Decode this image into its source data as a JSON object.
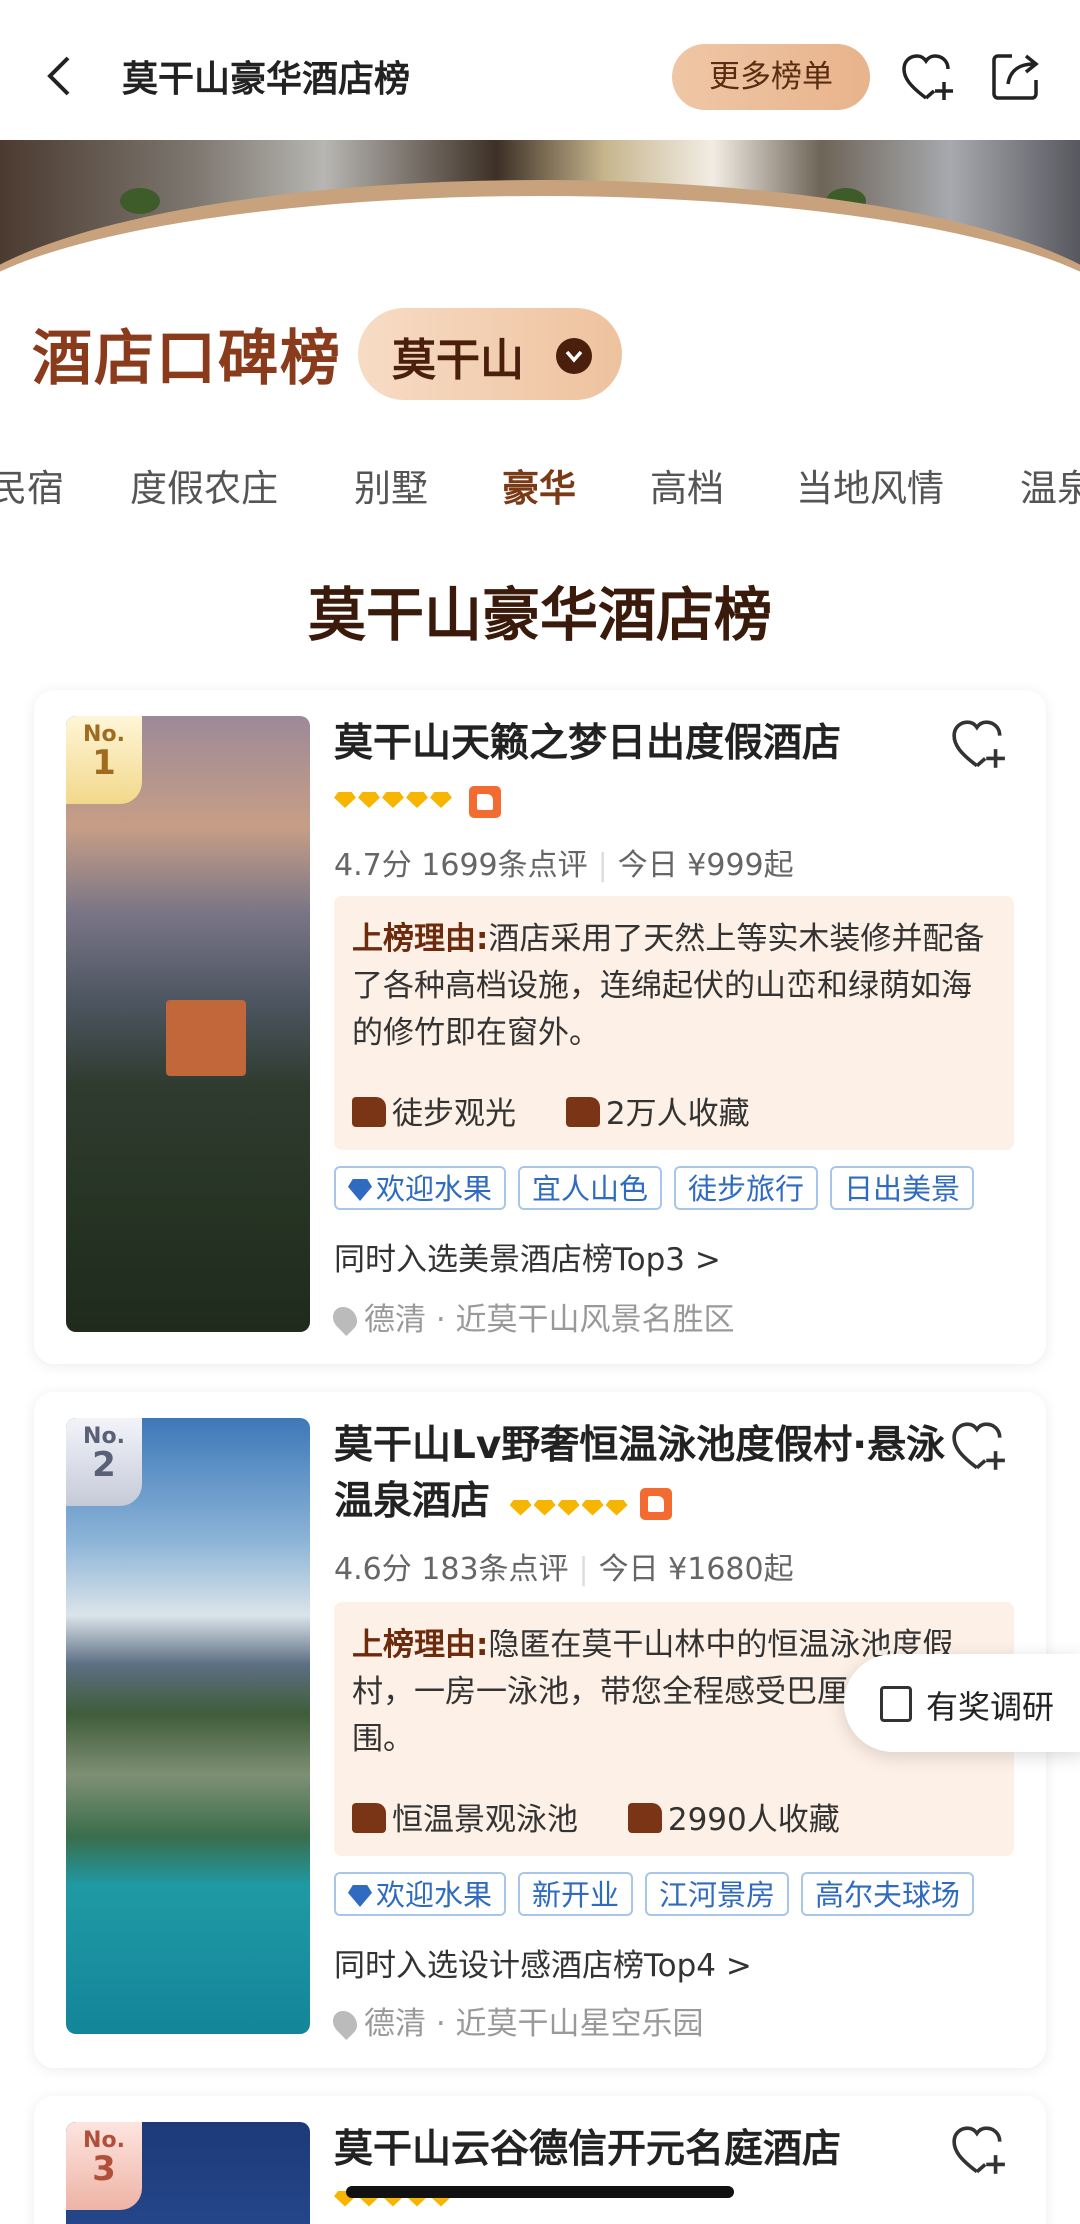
{
  "header": {
    "title": "莫干山豪华酒店榜",
    "more_label": "更多榜单"
  },
  "brand": {
    "logo_text": "酒店口碑榜",
    "city": "莫干山"
  },
  "tabs": [
    {
      "label": "民宿"
    },
    {
      "label": "度假农庄"
    },
    {
      "label": "别墅"
    },
    {
      "label": "豪华",
      "active": true
    },
    {
      "label": "高档"
    },
    {
      "label": "当地风情"
    },
    {
      "label": "温泉"
    }
  ],
  "list_title": "莫干山豪华酒店榜",
  "hotels": [
    {
      "rank_no": "No.",
      "rank": "1",
      "name": "莫干山天籁之梦日出度假酒店",
      "score": "4.7分",
      "reviews": "1699条点评",
      "price": "今日 ¥999起",
      "reason_label": "上榜理由:",
      "reason": "酒店采用了天然上等实木装修并配备了各种高档设施，连绵起伏的山峦和绿荫如海的修竹即在窗外。",
      "tips": [
        "徒步观光",
        "2万人收藏"
      ],
      "tags": [
        "欢迎水果",
        "宜人山色",
        "徒步旅行",
        "日出美景"
      ],
      "also_in": "同时入选美景酒店榜Top3 >",
      "location": "德清 · 近莫干山风景名胜区"
    },
    {
      "rank_no": "No.",
      "rank": "2",
      "name": "莫干山Lv野奢恒温泳池度假村·悬泳温泉酒店",
      "score": "4.6分",
      "reviews": "183条点评",
      "price": "今日 ¥1680起",
      "reason_label": "上榜理由:",
      "reason": "隐匿在莫干山林中的恒温泳池度假村，一房一泳池，带您全程感受巴厘岛度假氛围。",
      "tips": [
        "恒温景观泳池",
        "2990人收藏"
      ],
      "tags": [
        "欢迎水果",
        "新开业",
        "江河景房",
        "高尔夫球场"
      ],
      "also_in": "同时入选设计感酒店榜Top4 >",
      "location": "德清 · 近莫干山星空乐园"
    },
    {
      "rank_no": "No.",
      "rank": "3",
      "name": "莫干山云谷德信开元名庭酒店"
    }
  ],
  "survey": {
    "label": "有奖调研"
  },
  "colors": {
    "brand_brown": "#7a3a16",
    "tag_blue": "#2f6bc0",
    "star_gold": "#f7b400",
    "reason_bg": "#fdf0e6"
  }
}
